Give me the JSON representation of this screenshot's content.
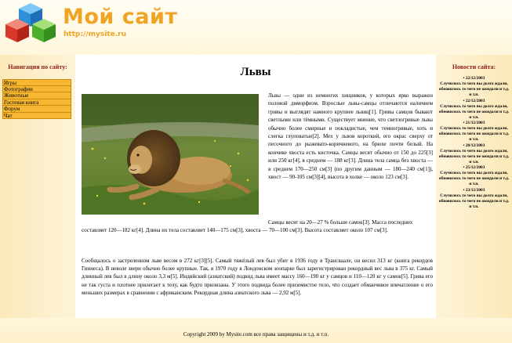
{
  "header": {
    "site_name": "Мой сайт",
    "site_url": "http://mysite.ru"
  },
  "colors": {
    "accent": "#f0a423",
    "heading": "#8b1c16",
    "nav_button": "#f7b733",
    "background": "#fdf3d9"
  },
  "nav": {
    "title": "Навигация по сайту:",
    "items": [
      {
        "label": "Игры"
      },
      {
        "label": "Фотографии"
      },
      {
        "label": "Животные"
      },
      {
        "label": "Гостевая книга"
      },
      {
        "label": "Форум"
      },
      {
        "label": "Чат"
      }
    ]
  },
  "main": {
    "title": "Львы",
    "photo_icon": "lion-photo",
    "para1": "Львы — одни из немногих хищников, у которых ярко выражен половой диморфизм. Взрослые львы-самцы отличаются наличием гривы и выглядят намного крупнее львиц[1]. Гривы самцов бывают светлыми или тёмными. Существует мнение, что светлогривые львы обычно более смирные и покладистые, чем темногривые, хоть и слегка глуповатые[2]. Мех у львов короткий, его окрас сверху от песочного до рыжевато-коричневого, на брюхе почти белый. На кончике хвоста есть кисточка. Самцы весят обычно от 150 до 225[3] или 250 кг[4], в среднем — 188 кг[3]. Длина тела самца без хвоста — в среднем 170—250 см[3] (по другим данным — 180—240 см[1]), хвост — 90-105 см[3][4], высота в холке — около 123 см[3].",
    "para2": "Самцы весят на 20—27 % больше самок[3]. Масса последних составляет 120—182 кг[4]. Длина их тела составляет 140—175 см[3], хвоста — 70—100 см[3]. Высота составляет около 107 см[3].",
    "para3": "Сообщалось о застреленном льве весом в 272 кг[3][5]. Самый тяжёлый лев был убит в 1936 году в Трансваале, он весил 313 кг (книга рекордов Гиннеса). В неволе звери обычно более крупные. Так, в 1970 году в Лондонском зоопарке был зарегистрирован рекордный вес льва в 375 кг. Самый длинный лев был в длину около 3,3 м[5]. Индийский (азиатский) подвид льва имеет массу 160—190 кг у самцов и 110—120 кг у самок[5]. Грива его не так густа и плотнее прилегает к телу, как будто прилизана. У этого подвида более приземистое тело, что создает обманчивое впечатление о его меньших размерах в сравнении с африканским. Рекордная длина азиатского льва — 2,92 м[5]."
  },
  "news": {
    "title": "Новости сайта:",
    "items": [
      {
        "date": "22/12/2003",
        "text": "Случилось то чего вы долго ждали, обновилось то чего не ожидали и т.д. и т.п."
      },
      {
        "date": "22/12/2003",
        "text": "Случилось то чего вы долго ждали, обновилось то чего не ожидали и т.д. и т.п."
      },
      {
        "date": "21/12/2003",
        "text": "Случилось то чего вы долго ждали, обновилось то чего не ожидали и т.д. и т.п."
      },
      {
        "date": "20/12/2003",
        "text": "Случилось то чего вы долго ждали, обновилось то чего не ожидали и т.д. и т.п."
      },
      {
        "date": "25/12/2003",
        "text": "Случилось то чего вы долго ждали, обновилось то чего не ожидали и т.д. и т.п."
      },
      {
        "date": "23/12/2003",
        "text": "Случилось то чего вы долго ждали, обновилось то чего не ожидали и т.д. и т.п."
      }
    ]
  },
  "footer": {
    "copyright": "Copyright 2009 by Mysite.com все права защищены и т.д. и т.п."
  }
}
